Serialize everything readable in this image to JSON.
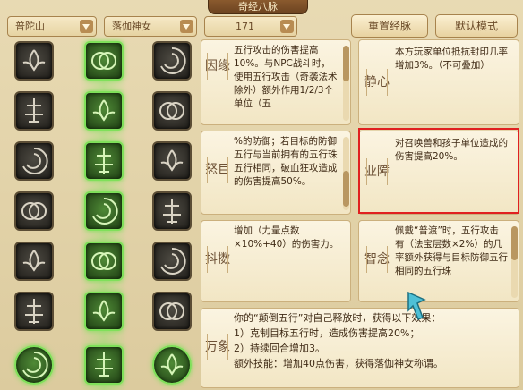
{
  "window": {
    "title": "奇经八脉"
  },
  "toolbar": {
    "location": "普陀山",
    "role": "落伽神女",
    "points": "171",
    "reset_label": "重置经脉",
    "default_label": "默认模式"
  },
  "skills": [
    {
      "name": "lotus-icon"
    },
    {
      "name": "rings-icon"
    },
    {
      "name": "flame-flower-icon"
    },
    {
      "name": "lotus-bloom-icon"
    },
    {
      "name": "flower-hand-icon"
    },
    {
      "name": "leaf-flower-icon"
    },
    {
      "name": "swirl-icon"
    },
    {
      "name": "hand-wave-icon"
    },
    {
      "name": "sun-icon"
    },
    {
      "name": "bamboo-icon"
    },
    {
      "name": "mudra-icon"
    },
    {
      "name": "lion-icon"
    },
    {
      "name": "arrow-up-icon"
    },
    {
      "name": "lotus-stack-icon"
    },
    {
      "name": "lotus-open-icon"
    },
    {
      "name": "bubble-icon"
    },
    {
      "name": "peacock-icon"
    },
    {
      "name": "whirl-icon"
    },
    {
      "name": "wreath-icon"
    },
    {
      "name": "pillar-icon"
    },
    {
      "name": "wreath-icon"
    }
  ],
  "panels": {
    "yinyuan": {
      "tag": "因缘",
      "text": "五行攻击的伤害提高10%。与NPC战斗时，使用五行攻击（奇袭法术除外）额外作用1/2/3个单位（五"
    },
    "jingxin": {
      "tag": "静心",
      "text": "本方玩家单位抵抗封印几率增加3%。（不可叠加）"
    },
    "numu": {
      "tag": "怒目",
      "text": "%的防御；若目标的防御五行与当前拥有的五行珠五行相同，破血狂攻造成的伤害提高50%。"
    },
    "yezhang": {
      "tag": "业障",
      "text": "对召唤兽和孩子单位造成的伤害提高20%。"
    },
    "dousou": {
      "tag": "抖擞",
      "text": "增加（力量点数×10%+40）的伤害力。"
    },
    "zhihui": {
      "tag": "智念",
      "text": "佩戴“普渡”时，五行攻击有（法宝层数×2%）的几率额外获得与目标防御五行相同的五行珠"
    },
    "wanxiang": {
      "tag": "万象",
      "lines": [
        "你的“颠倒五行”对自己释放时，获得以下效果：",
        "1）克制目标五行时，造成伤害提高20%；",
        "2）持续回合增加3。",
        "额外技能：增加40点伤害，获得落伽神女称谓。"
      ]
    }
  },
  "colors": {
    "highlight": "#e02020",
    "lit_border": "#7fe05a"
  }
}
